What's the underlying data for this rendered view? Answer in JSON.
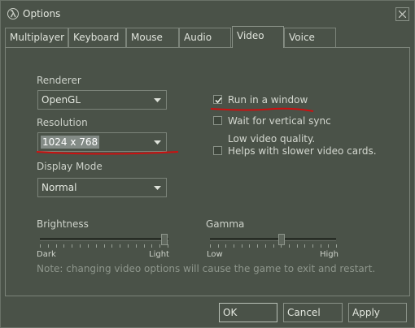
{
  "window": {
    "title": "Options"
  },
  "tabs": [
    {
      "label": "Multiplayer"
    },
    {
      "label": "Keyboard"
    },
    {
      "label": "Mouse"
    },
    {
      "label": "Audio"
    },
    {
      "label": "Video"
    },
    {
      "label": "Voice"
    }
  ],
  "active_tab": "Video",
  "video": {
    "renderer_label": "Renderer",
    "renderer_value": "OpenGL",
    "resolution_label": "Resolution",
    "resolution_value": "1024 x 768",
    "display_mode_label": "Display Mode",
    "display_mode_value": "Normal",
    "run_in_window": {
      "label": "Run in a window",
      "checked": true
    },
    "vertical_sync": {
      "label": "Wait for vertical sync",
      "checked": false
    },
    "low_quality": {
      "label_line1": "Low video quality.",
      "label_line2": "Helps with slower video cards.",
      "checked": false
    },
    "brightness": {
      "label": "Brightness",
      "min_label": "Dark",
      "max_label": "Light",
      "level": 1.0
    },
    "gamma": {
      "label": "Gamma",
      "min_label": "Low",
      "max_label": "High",
      "level": 0.5
    },
    "note": "Note: changing video options will cause the game to exit and restart."
  },
  "buttons": {
    "ok": "OK",
    "cancel": "Cancel",
    "apply": "Apply"
  },
  "colors": {
    "annotation": "#cc1010",
    "accent_highlight": "#838b86"
  },
  "icons": {
    "app": "half-life-lambda-icon",
    "close": "close-icon",
    "dropdown": "chevron-down-icon",
    "check": "checkmark-icon"
  }
}
